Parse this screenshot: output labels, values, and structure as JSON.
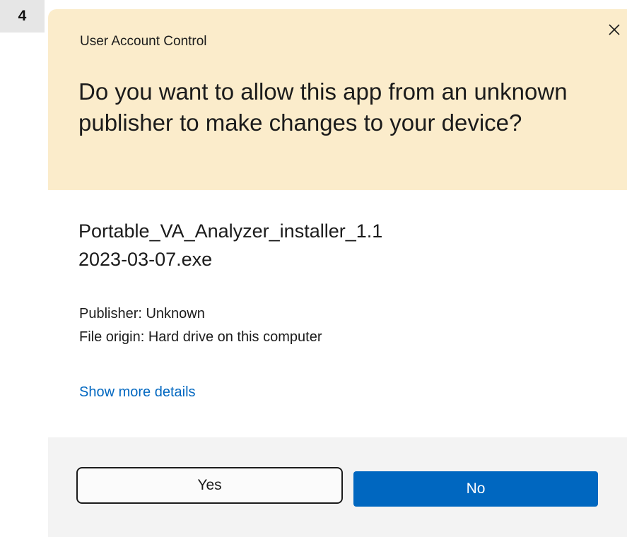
{
  "step_badge": "4",
  "dialog": {
    "window_title": "User Account Control",
    "close_icon": "close-icon",
    "question": "Do you want to allow this app from an unknown publisher to make changes to your device?",
    "program_name_line1": "Portable_VA_Analyzer_installer_1.1",
    "program_name_line2": "2023-03-07.exe",
    "publisher": "Publisher: Unknown",
    "file_origin": "File origin: Hard drive on this computer",
    "details_link": "Show more details",
    "yes_label": "Yes",
    "no_label": "No"
  },
  "colors": {
    "header_bg": "#fbeccb",
    "footer_bg": "#f3f3f3",
    "accent": "#0067c0",
    "badge_bg": "#e6e6e6"
  }
}
